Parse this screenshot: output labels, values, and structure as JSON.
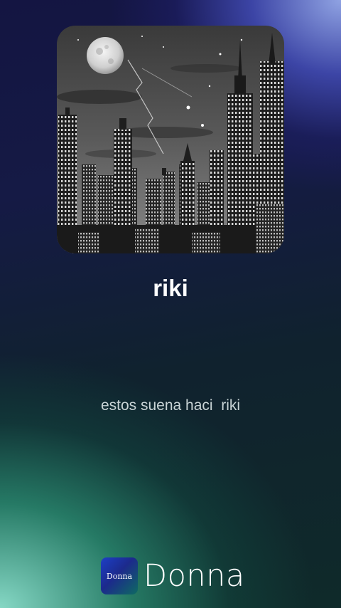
{
  "song": {
    "title": "riki",
    "lyric": "estos suena haci  riki"
  },
  "brand": {
    "icon_text": "Donna",
    "name": "Donna"
  },
  "cover": {
    "icon": "night-city-artwork"
  }
}
